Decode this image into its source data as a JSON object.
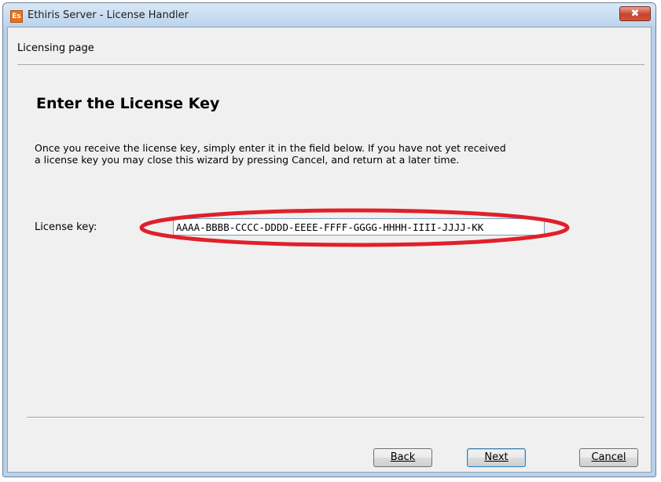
{
  "window": {
    "title": "Ethiris Server - License Handler",
    "icon_text": "Es",
    "close_symbol": "✖"
  },
  "header": {
    "label": "Licensing page"
  },
  "page": {
    "title": "Enter the License Key",
    "description": "Once you receive the license key, simply enter it in the field below. If you have not yet received a license key you may close this wizard by pressing Cancel, and return at a later time."
  },
  "license": {
    "label": "License key:",
    "value": "AAAA-BBBB-CCCC-DDDD-EEEE-FFFF-GGGG-HHHH-IIII-JJJJ-KK"
  },
  "buttons": {
    "back": "Back",
    "next": "Next",
    "cancel": "Cancel"
  },
  "colors": {
    "highlight": "#e0202a",
    "title_bar": "#bcd3ec",
    "client_bg": "#f0f0f0"
  }
}
